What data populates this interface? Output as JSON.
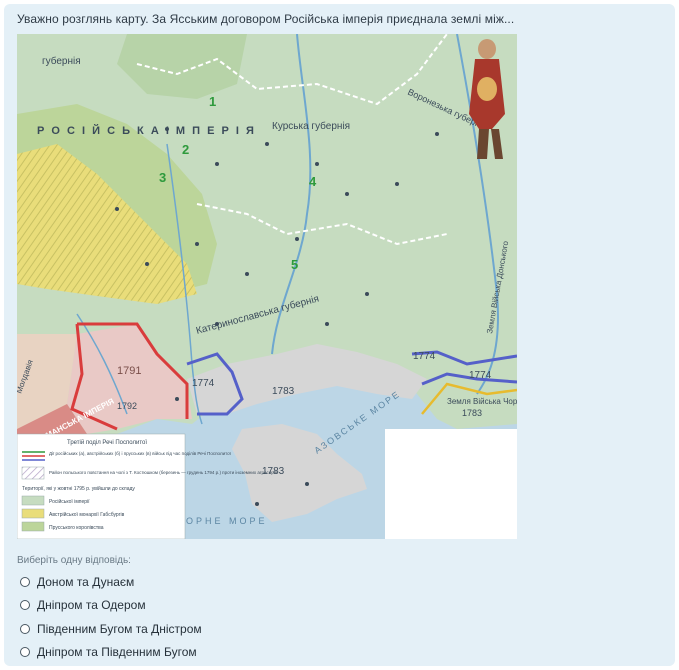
{
  "question": {
    "text": "Уважно розглянь карту. За Ясським договором Російська імперія приєднала землі між..."
  },
  "map": {
    "region_numbers": [
      "1",
      "2",
      "3",
      "4",
      "5"
    ],
    "labels": {
      "empire": "Р О С І Й С Ь К А   І М П Е Р І Я",
      "gubernia_north": "губернія",
      "gubernia_kursk": "Курська губернія",
      "voronezh": "Воронезька губернія",
      "kat_gubernia": "Катеринославська губернія",
      "az_sea": "АЗОВСЬКЕ МОРЕ",
      "black_sea": "ЧОРНЕ МОРЕ",
      "osman": "ОСМАНСЬКА ІМПЕРІЯ",
      "moldavia": "Молдавія",
      "don": "Земля Війська Донського",
      "chorn": "Земля Війська Чорноморського",
      "y1791": "1791",
      "y1774a": "1774",
      "y1774b": "1774",
      "y1774c": "1774",
      "y1783a": "1783",
      "y1783b": "1783",
      "y1783c": "1783",
      "y1792": "1792"
    },
    "legend": {
      "title": "Третій поділ Речі Посполитої",
      "items": [
        "Дії російських (а), австрійських (б) і прусських (в) військ під час поділів Речі Посполитої",
        "Район польського повстання на чолі з Т. Костюшком (березень — грудень 1794 р.) проти іноземних агресорів",
        "Території, які у жовтні 1795 р. увійшли до складу",
        "Російської імперії",
        "Австрійської монархії Габсбургів",
        "Прусського королівства"
      ]
    },
    "colors": {
      "land_green": "#c6dcc0",
      "annexed_pink": "#e9c9c6",
      "crimea_gray": "#d6d6d6",
      "sea": "#bcd6e6",
      "austria_yellow": "#e9dd7a",
      "border_red": "#d93c3c",
      "border_blue": "#5560c9",
      "border_yellow": "#e7bb2e"
    }
  },
  "answers": {
    "hint": "Виберіть одну відповідь:",
    "options": [
      "Доном та Дунаєм",
      "Дніпром та Одером",
      "Південним Бугом та Дністром",
      "Дніпром та Південним Бугом"
    ]
  }
}
